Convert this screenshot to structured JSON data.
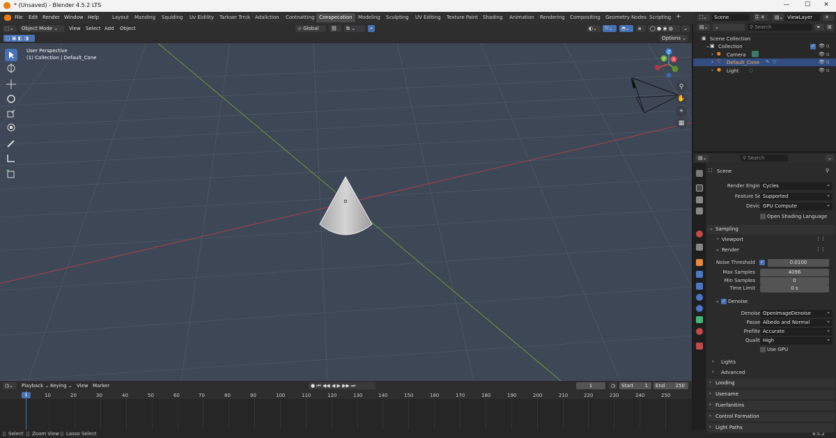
{
  "window": {
    "title": "* (Unsaved) - Blender 4.5.2 LTS",
    "minimize": "—",
    "maximize": "☐",
    "close": "✕"
  },
  "menubar": {
    "items": [
      "File",
      "Edit",
      "Render",
      "Window",
      "Help"
    ],
    "workspaces": [
      "Layout",
      "Manding",
      "Squiding",
      "Uv Eidility",
      "Tarkser Trrck",
      "Adaliction",
      "Contnatting",
      "Conspecation",
      "Modeling",
      "Sculpting",
      "UV Editing",
      "Texture Paint",
      "Shading",
      "Animation",
      "Rendering",
      "Compositing",
      "Geometry Nodes",
      "Scripting"
    ],
    "active_workspace": "Conspecation",
    "add_tab": "+"
  },
  "viewport_header": {
    "mode": "Object Mode",
    "menus": [
      "View",
      "Select",
      "Add",
      "Object"
    ],
    "orientation": "Global",
    "options": "Options"
  },
  "viewport": {
    "perspective": "User Perspective",
    "collection_info": "(1) Collection | Default_Cone",
    "gizmo": {
      "x": "X",
      "y": "Y",
      "z": "Z"
    }
  },
  "timeline": {
    "menus": [
      "Playback",
      "Keying",
      "View",
      "Marker"
    ],
    "current_frame": "1",
    "start_label": "Start",
    "start": "1",
    "end_label": "End",
    "end": "250",
    "ticks": [
      "1",
      "10",
      "20",
      "30",
      "40",
      "50",
      "60",
      "70",
      "80",
      "90",
      "100",
      "110",
      "120",
      "130",
      "140",
      "150",
      "160",
      "170",
      "180",
      "190",
      "200",
      "210",
      "220",
      "230",
      "240",
      "250"
    ]
  },
  "statusbar": {
    "select": "Select",
    "zoom": "Zoom View",
    "lasso": "Lasso Select",
    "version": "4.5.2"
  },
  "outliner": {
    "scene": "Scene",
    "view_layer": "ViewLayer",
    "search_placeholder": "Search",
    "root": "Scene Collection",
    "collection": "Collection",
    "items": [
      {
        "name": "Camera"
      },
      {
        "name": "Default_Cone",
        "selected": true
      },
      {
        "name": "Light"
      }
    ]
  },
  "properties": {
    "search_placeholder": "Search",
    "context": "Scene",
    "render_engine_label": "Render Engine",
    "render_engine": "Cycles",
    "feature_set_label": "Feature Set",
    "feature_set": "Supported",
    "device_label": "Device",
    "device": "GPU Compute",
    "osl_label": "Open Shading Language",
    "sampling": "Sampling",
    "viewport": "Viewport",
    "render": "Render",
    "noise_threshold_label": "Noise Threshold",
    "noise_threshold": "0.0100",
    "max_samples_label": "Max Samples",
    "max_samples": "4096",
    "min_samples_label": "Min Samples",
    "min_samples": "0",
    "time_limit_label": "Time Limit",
    "time_limit": "0 s",
    "denoise": "Denoise",
    "denoiser_label": "Denoiser",
    "denoiser": "OpenImageDenoise",
    "passes_label": "Passes",
    "passes": "Albedo and Normal",
    "prefilter_label": "Prefilter",
    "prefilter": "Accurate",
    "quality_label": "Quality",
    "quality": "High",
    "use_gpu_label": "Use GPU",
    "lights": "Lights",
    "advanced": "Advanced",
    "loading": "Looding",
    "username": "Usename",
    "fuerfanitins": "Fuerfanitins",
    "control_formation": "Control Formation",
    "light_paths": "Light Paths"
  },
  "colors": {
    "accent": "#4772b3",
    "x_axis": "#e8434f",
    "y_axis": "#72b63a",
    "z_axis": "#3f8de8"
  }
}
